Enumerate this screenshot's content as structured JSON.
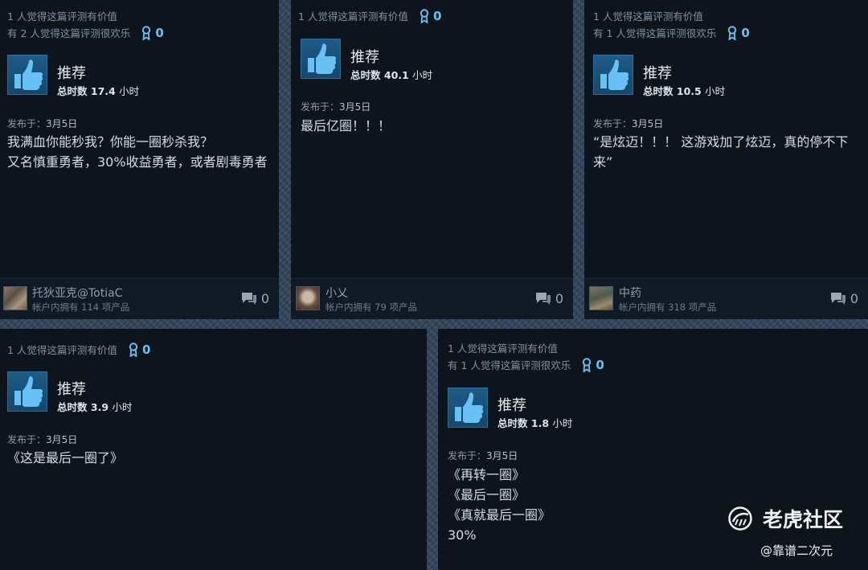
{
  "reviews": [
    {
      "helpful_line": "1 人觉得这篇评测有价值",
      "funny_line": "有 2 人觉得这篇评测很欢乐",
      "award_count": "0",
      "recommendation": "推荐",
      "hours_label": "总时数",
      "hours_value": "17.4",
      "hours_unit": "小时",
      "posted_label": "发布于：",
      "posted_date": "3月5日",
      "content": [
        "我满血你能秒我？你能一圈秒杀我？",
        "又名慎重勇者，30%收益勇者，或者剧毒勇者"
      ],
      "author": "托狄亚克@TotiaC",
      "products": "帐户内拥有 114 项产品",
      "comments": "0"
    },
    {
      "helpful_line": "1 人觉得这篇评测有价值",
      "award_count": "0",
      "recommendation": "推荐",
      "hours_label": "总时数",
      "hours_value": "40.1",
      "hours_unit": "小时",
      "posted_label": "发布于：",
      "posted_date": "3月5日",
      "content": [
        "最后亿圈！！！"
      ],
      "author": "小乂",
      "products": "帐户内拥有 79 项产品",
      "comments": "0"
    },
    {
      "helpful_line": "1 人觉得这篇评测有价值",
      "funny_line": "有 1 人觉得这篇评测很欢乐",
      "award_count": "0",
      "recommendation": "推荐",
      "hours_label": "总时数",
      "hours_value": "10.5",
      "hours_unit": "小时",
      "posted_label": "发布于：",
      "posted_date": "3月5日",
      "content": [
        "“是炫迈！！！ 这游戏加了炫迈，真的停不下来”"
      ],
      "author": "中药",
      "products": "帐户内拥有 318 项产品",
      "comments": "0"
    },
    {
      "helpful_line": "1 人觉得这篇评测有价值",
      "award_count": "0",
      "recommendation": "推荐",
      "hours_label": "总时数",
      "hours_value": "3.9",
      "hours_unit": "小时",
      "posted_label": "发布于：",
      "posted_date": "3月5日",
      "content": [
        "《这是最后一圈了》"
      ]
    },
    {
      "helpful_line": "1 人觉得这篇评测有价值",
      "funny_line": "有 1 人觉得这篇评测很欢乐",
      "award_count": "0",
      "recommendation": "推荐",
      "hours_label": "总时数",
      "hours_value": "1.8",
      "hours_unit": "小时",
      "posted_label": "发布于：",
      "posted_date": "3月5日",
      "content": [
        "《再转一圈》",
        "《最后一圈》",
        "《真就最后一圈》",
        "30%"
      ]
    }
  ],
  "watermark": {
    "name": "老虎社区",
    "handle": "@靠谱二次元"
  },
  "icons": {
    "thumb": "thumbs-up-icon",
    "award": "award-ribbon-icon",
    "comment": "comment-bubble-icon",
    "logo": "tiger-logo-icon"
  },
  "colors": {
    "card_bg": "#0e141b",
    "accent_blue": "#66c0f4",
    "thumb_bg": "#1e5b86"
  }
}
